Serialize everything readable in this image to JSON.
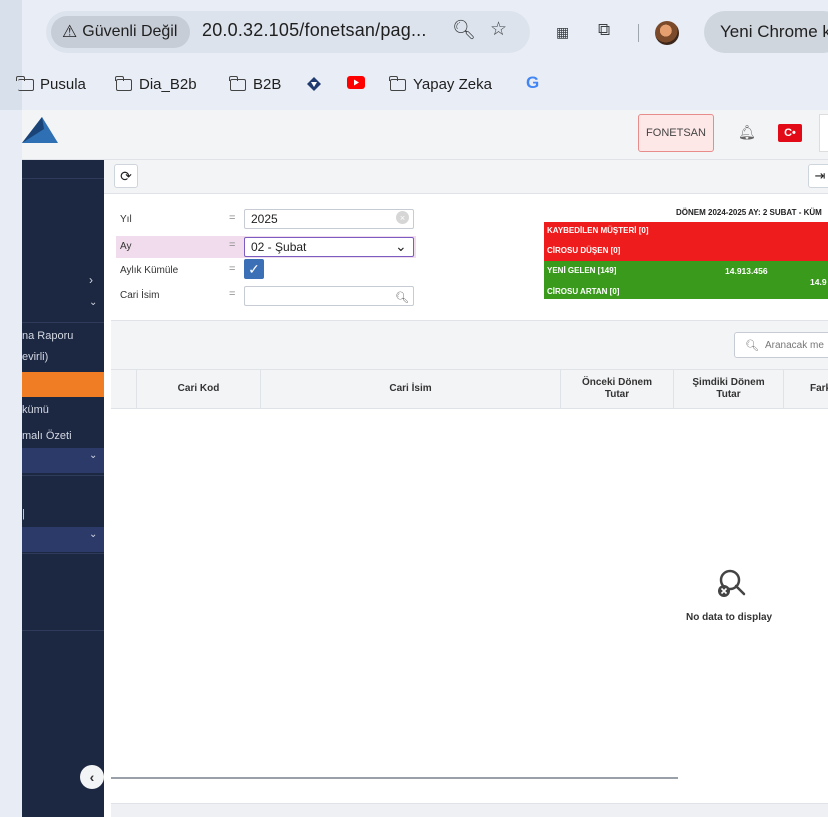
{
  "browser": {
    "security_label": "Güvenli Değil",
    "url": "20.0.32.105/fonetsan/pag...",
    "profile_label": "Yeni Chrome k",
    "bookmarks": [
      "Pusula",
      "Dia_B2b",
      "B2B",
      "Yapay Zeka"
    ]
  },
  "header": {
    "company_button": "FONETSAN",
    "flag_symbol": "C•",
    "accent_color": "#f07d23"
  },
  "sidebar": {
    "items": [
      {
        "label": "na Raporu"
      },
      {
        "label": "evirli)"
      },
      {
        "label": "kümü"
      },
      {
        "label": "malı Özeti"
      }
    ],
    "collapse_symbol": "‹"
  },
  "filters": {
    "year_label": "Yıl",
    "year_value": "2025",
    "month_label": "Ay",
    "month_value": "02 - Şubat",
    "cumulative_label": "Aylık Kümüle",
    "name_label": "Cari İsim",
    "name_value": "",
    "eq": "="
  },
  "summary": {
    "title": "DÖNEM 2024-2025 AY: 2 SUBAT - KÜM",
    "lost": "KAYBEDİLEN MÜŞTERİ [0]",
    "revenue_down": "CİROSU DÜŞEN [0]",
    "new": "YENİ GELEN [149]",
    "new_value": "14.913.456",
    "new_value_2": "14.9",
    "revenue_up": "CİROSU ARTAN [0]",
    "red_color": "#ee1c1c",
    "green_color": "#3a9a1c"
  },
  "grid": {
    "search_placeholder": "Aranacak me",
    "columns": {
      "code": "Cari Kod",
      "name": "Cari İsim",
      "prev": "Önceki Dönem Tutar",
      "curr": "Şimdiki Dönem Tutar",
      "diff": "Fark"
    },
    "empty_text": "No data to display"
  }
}
